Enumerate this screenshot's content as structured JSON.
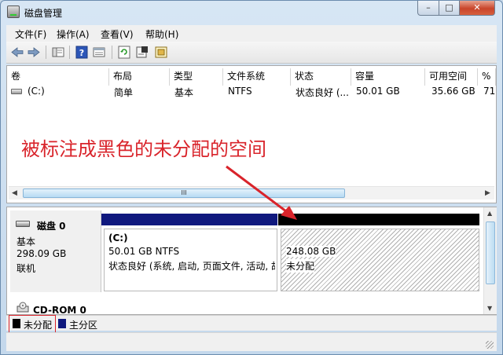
{
  "window": {
    "title": "磁盘管理"
  },
  "titlebar_buttons": {
    "minimize": "–",
    "maximize": "□",
    "close": "✕"
  },
  "menu": [
    "文件(F)",
    "操作(A)",
    "查看(V)",
    "帮助(H)"
  ],
  "toolbar_icons": [
    "back-arrow-icon",
    "forward-arrow-icon",
    "console-tree-icon",
    "help-icon",
    "view-icon",
    "refresh-icon",
    "properties-icon",
    "export-icon"
  ],
  "volume_list": {
    "columns": [
      "卷",
      "布局",
      "类型",
      "文件系统",
      "状态",
      "容量",
      "可用空间",
      "%"
    ],
    "rows": [
      {
        "volume": "(C:)",
        "layout": "简单",
        "type": "基本",
        "fs": "NTFS",
        "status": "状态良好 (...",
        "capacity": "50.01 GB",
        "free": "35.66 GB",
        "pct": "71"
      }
    ],
    "scroll_thumb_label": "III"
  },
  "annotation": {
    "text": "被标注成黑色的未分配的空间",
    "color": "#d9242b"
  },
  "disk0": {
    "name": "磁盘 0",
    "kind": "基本",
    "size": "298.09 GB",
    "state": "联机",
    "partitions": [
      {
        "name": "(C:)",
        "size_fs": "50.01 GB NTFS",
        "status": "状态良好 (系统, 启动, 页面文件, 活动, 故"
      },
      {
        "size": "248.08 GB",
        "label": "未分配"
      }
    ]
  },
  "cdrom": {
    "name": "CD-ROM 0"
  },
  "legend": [
    {
      "label": "未分配",
      "color": "#000000"
    },
    {
      "label": "主分区",
      "color": "#10197e"
    }
  ]
}
